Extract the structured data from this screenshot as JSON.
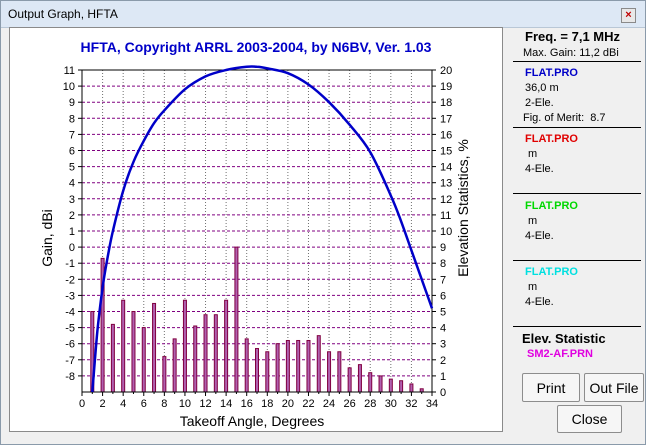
{
  "window": {
    "title": "Output Graph, HFTA"
  },
  "chart_data": {
    "type": "line",
    "title": "HFTA, Copyright ARRL 2003-2004, by N6BV, Ver. 1.03",
    "xlabel": "Takeoff Angle, Degrees",
    "ylabel": "Gain, dBi",
    "y2label": "Elevation Statistics, %",
    "xlim": [
      0,
      34
    ],
    "ylim": [
      -9,
      11
    ],
    "y2lim": [
      0,
      20
    ],
    "x_ticks": [
      "0",
      "2",
      "4",
      "6",
      "8",
      "10",
      "12",
      "14",
      "16",
      "18",
      "20",
      "22",
      "24",
      "26",
      "28",
      "30",
      "32",
      "34"
    ],
    "y_ticks": [
      "11",
      "10",
      "9",
      "8",
      "7",
      "6",
      "5",
      "4",
      "3",
      "2",
      "1",
      "0",
      "-1",
      "-2",
      "-3",
      "-4",
      "-5",
      "-6",
      "-7",
      "-8"
    ],
    "y2_ticks": [
      "20",
      "19",
      "18",
      "17",
      "16",
      "15",
      "14",
      "13",
      "12",
      "11",
      "10",
      "9",
      "8",
      "7",
      "6",
      "5",
      "4",
      "3",
      "2",
      "1",
      "0"
    ],
    "grid": true,
    "series": [
      {
        "name": "FLAT.PRO 2-Ele.",
        "color": "#0000c8",
        "x": [
          1,
          1.5,
          2,
          2.5,
          3,
          4,
          5,
          6,
          7,
          8,
          10,
          12,
          14,
          16,
          17,
          18,
          20,
          22,
          24,
          26,
          28,
          30,
          31,
          32,
          33,
          34
        ],
        "y": [
          -9.0,
          -5.2,
          -2.5,
          -0.6,
          1.0,
          3.5,
          5.3,
          6.6,
          7.7,
          8.5,
          9.8,
          10.6,
          11.0,
          11.2,
          11.2,
          11.1,
          10.8,
          10.1,
          9.0,
          7.6,
          5.9,
          3.2,
          1.6,
          -0.2,
          -2.0,
          -3.8
        ]
      }
    ],
    "elevation_statistics": {
      "name": "SM2-AF.PRN",
      "color": "#800040",
      "x": [
        1,
        2,
        3,
        4,
        5,
        6,
        7,
        8,
        9,
        10,
        11,
        12,
        13,
        14,
        15,
        16,
        17,
        18,
        19,
        20,
        21,
        22,
        23,
        24,
        25,
        26,
        27,
        28,
        29,
        30,
        31,
        32,
        33
      ],
      "values": [
        5.0,
        8.3,
        4.2,
        5.7,
        5.0,
        4.0,
        5.5,
        2.2,
        3.3,
        5.7,
        4.1,
        4.8,
        4.8,
        5.7,
        9.0,
        3.3,
        2.7,
        2.5,
        3.0,
        3.2,
        3.2,
        3.2,
        3.5,
        2.5,
        2.5,
        1.5,
        1.7,
        1.2,
        1.0,
        0.8,
        0.7,
        0.5,
        0.2
      ]
    }
  },
  "info": {
    "freq": "Freq. = 7,1 MHz",
    "max_gain": "Max. Gain: 11,2 dBi",
    "entries": [
      {
        "file": "FLAT.PRO",
        "color": "#0000c8",
        "height": "36,0 m",
        "type": "2-Ele.",
        "fom_label": "Fig. of Merit:",
        "fom_value": "8.7"
      },
      {
        "file": "FLAT.PRO",
        "color": "#e00000",
        "height": " m",
        "type": "4-Ele."
      },
      {
        "file": "FLAT.PRO",
        "color": "#00d800",
        "height": " m",
        "type": "4-Ele."
      },
      {
        "file": "FLAT.PRO",
        "color": "#00e0e0",
        "height": " m",
        "type": "4-Ele."
      }
    ],
    "elev_heading": "Elev. Statistic",
    "elev_file": "SM2-AF.PRN",
    "elev_file_color": "#e000e0"
  },
  "buttons": {
    "print": "Print",
    "out_file": "Out File",
    "close": "Close"
  }
}
